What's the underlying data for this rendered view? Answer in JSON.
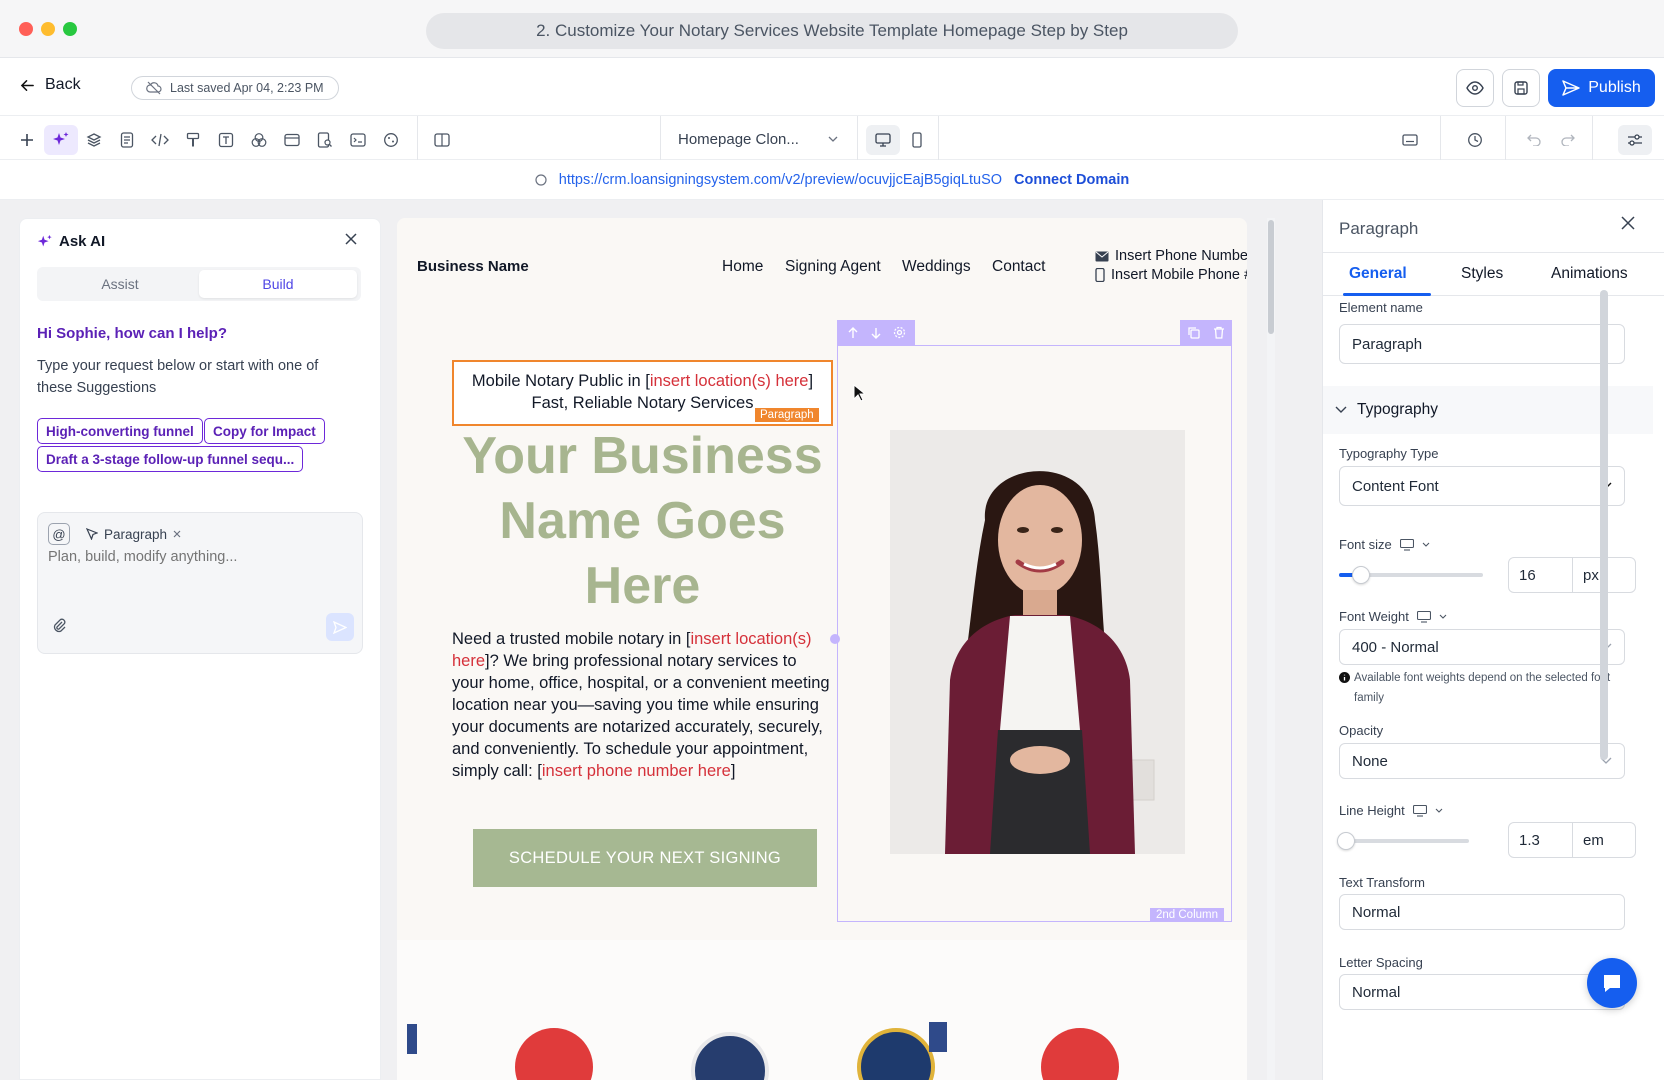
{
  "window": {
    "title": "2. Customize Your Notary Services Website Template Homepage Step by Step"
  },
  "topbar": {
    "back_label": "Back",
    "last_saved": "Last saved Apr 04, 2:23 PM",
    "publish_label": "Publish"
  },
  "toolbar": {
    "page_select": "Homepage Clon..."
  },
  "urlbar": {
    "preview_url": "https://crm.loansigningsystem.com/v2/preview/ocuvjjcEajB5giqLtuSO",
    "connect_domain": "Connect Domain"
  },
  "ai_panel": {
    "title": "Ask AI",
    "tabs": {
      "assist": "Assist",
      "build": "Build"
    },
    "greeting": "Hi Sophie, how can I help?",
    "intro": "Type your request below or start with one of these Suggestions",
    "suggestions": [
      "High-converting funnel",
      "Copy for Impact",
      "Draft a 3-stage follow-up funnel sequ..."
    ],
    "context_chip": "Paragraph",
    "at_symbol": "@",
    "placeholder": "Plan, build, modify anything..."
  },
  "site": {
    "brand": "Business Name",
    "nav": [
      "Home",
      "Signing Agent",
      "Weddings",
      "Contact"
    ],
    "phone": "Insert Phone Number",
    "mobile": "Insert Mobile Phone #",
    "selected_paragraph": {
      "line1_prefix": "Mobile Notary Public in [",
      "line1_highlight": "insert location(s) here",
      "line1_suffix": "]",
      "line2": "Fast, Reliable Notary Services",
      "tag": "Paragraph"
    },
    "hero_heading": "Your Business Name Goes Here",
    "hero_body": {
      "p1": "Need a trusted mobile notary in [",
      "h1": "insert location(s) here",
      "p2": "]? We bring professional notary services to your home, office, hospital, or a convenient meeting location near you—saving you time while ensuring your documents are notarized accurately, securely, and conveniently. To schedule your appointment, simply call: [",
      "h2": "insert phone number here",
      "p3": "]"
    },
    "cta_label": "SCHEDULE YOUR NEXT SIGNING",
    "column_tag": "2nd Column"
  },
  "properties": {
    "title": "Paragraph",
    "tabs": [
      "General",
      "Styles",
      "Animations"
    ],
    "element_name_label": "Element name",
    "element_name_value": "Paragraph",
    "typography_section": "Typography",
    "typography_type_label": "Typography Type",
    "typography_type_value": "Content Font",
    "font_size_label": "Font size",
    "font_size_value": "16",
    "font_size_unit": "px",
    "font_size_level": 0.15,
    "font_weight_label": "Font Weight",
    "font_weight_value": "400 - Normal",
    "font_weight_note": "Available font weights depend on the selected font family",
    "opacity_label": "Opacity",
    "opacity_value": "None",
    "line_height_label": "Line Height",
    "line_height_value": "1.3",
    "line_height_unit": "em",
    "line_height_level": 0.05,
    "text_transform_label": "Text Transform",
    "text_transform_value": "Normal",
    "letter_spacing_label": "Letter Spacing",
    "letter_spacing_value": "Normal"
  },
  "colors": {
    "accent": "#155eef",
    "hero_green": "#a7b58f",
    "cta_green": "#a6b892",
    "highlight_red": "#d5313a",
    "selection_orange": "#f0862d",
    "column_purple": "#c4b5fd"
  }
}
